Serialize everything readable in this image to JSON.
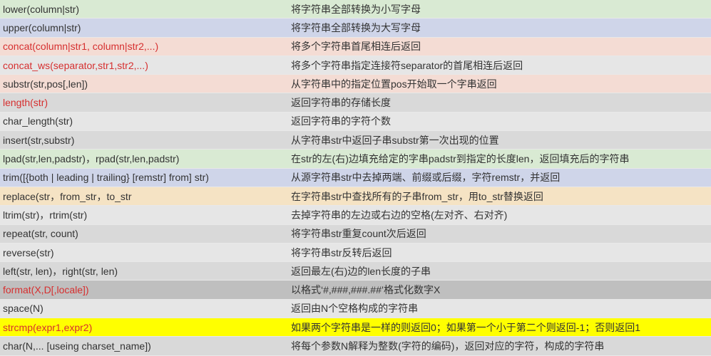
{
  "rows": [
    {
      "func": "lower(column|str)",
      "desc": "将字符串全部转换为小写字母",
      "bg": "bg-green",
      "fg": "fg-black"
    },
    {
      "func": "upper(column|str)",
      "desc": "将字符串全部转换为大写字母",
      "bg": "bg-blue",
      "fg": "fg-black"
    },
    {
      "func": "concat(column|str1, column|str2,...)",
      "desc": "将多个字符串首尾相连后返回",
      "bg": "bg-peach",
      "fg": "fg-red"
    },
    {
      "func": "concat_ws(separator,str1,str2,...)",
      "desc": "将多个字符串指定连接符separator的首尾相连后返回",
      "bg": "bg-gray",
      "fg": "fg-red"
    },
    {
      "func": "substr(str,pos[,len])",
      "desc": "从字符串中的指定位置pos开始取一个字串返回",
      "bg": "bg-peach",
      "fg": "fg-black"
    },
    {
      "func": "length(str)",
      "desc": "返回字符串的存储长度",
      "bg": "bg-gray2",
      "fg": "fg-red"
    },
    {
      "func": "char_length(str)",
      "desc": "返回字符串的字符个数",
      "bg": "bg-gray",
      "fg": "fg-black"
    },
    {
      "func": "insert(str,substr)",
      "desc": "从字符串str中返回子串substr第一次出现的位置",
      "bg": "bg-gray2",
      "fg": "fg-black"
    },
    {
      "func": "lpad(str,len,padstr)，rpad(str,len,padstr)",
      "desc": "在str的左(右)边填充给定的字串padstr到指定的长度len，返回填充后的字符串",
      "bg": "bg-green",
      "fg": "fg-black"
    },
    {
      "func": "trim([{both | leading | trailing} [remstr] from] str)",
      "desc": "从源字符串str中去掉两端、前缀或后缀，字符remstr，并返回",
      "bg": "bg-blue",
      "fg": "fg-black"
    },
    {
      "func": "replace(str，from_str，to_str",
      "desc": "在字符串str中查找所有的子串from_str，用to_str替换返回",
      "bg": "bg-gold",
      "fg": "fg-black"
    },
    {
      "func": "ltrim(str)，rtrim(str)",
      "desc": "去掉字符串的左边或右边的空格(左对齐、右对齐)",
      "bg": "bg-gray",
      "fg": "fg-black"
    },
    {
      "func": "repeat(str, count)",
      "desc": "将字符串str重复count次后返回",
      "bg": "bg-gray2",
      "fg": "fg-black"
    },
    {
      "func": "reverse(str)",
      "desc": "将字符串str反转后返回",
      "bg": "bg-gray",
      "fg": "fg-black"
    },
    {
      "func": "left(str, len)，right(str, len)",
      "desc": "返回最左(右)边的len长度的子串",
      "bg": "bg-gray2",
      "fg": "fg-black"
    },
    {
      "func": "format(X,D[,locale])",
      "desc": "以格式‘#,###,###.##’格式化数字X",
      "bg": "bg-dkgray",
      "fg": "fg-red"
    },
    {
      "func": "space(N)",
      "desc": "返回由N个空格构成的字符串",
      "bg": "bg-gray",
      "fg": "fg-black"
    },
    {
      "func": "strcmp(expr1,expr2)",
      "desc": "如果两个字符串是一样的则返回0；如果第一个小于第二个则返回-1；否则返回1",
      "bg": "bg-yellow",
      "fg": "fg-red"
    },
    {
      "func": "char(N,... [useing  charset_name])",
      "desc": "将每个参数N解释为整数(字符的编码)，返回对应的字符，构成的字符串",
      "bg": "bg-gray2",
      "fg": "fg-black"
    }
  ]
}
